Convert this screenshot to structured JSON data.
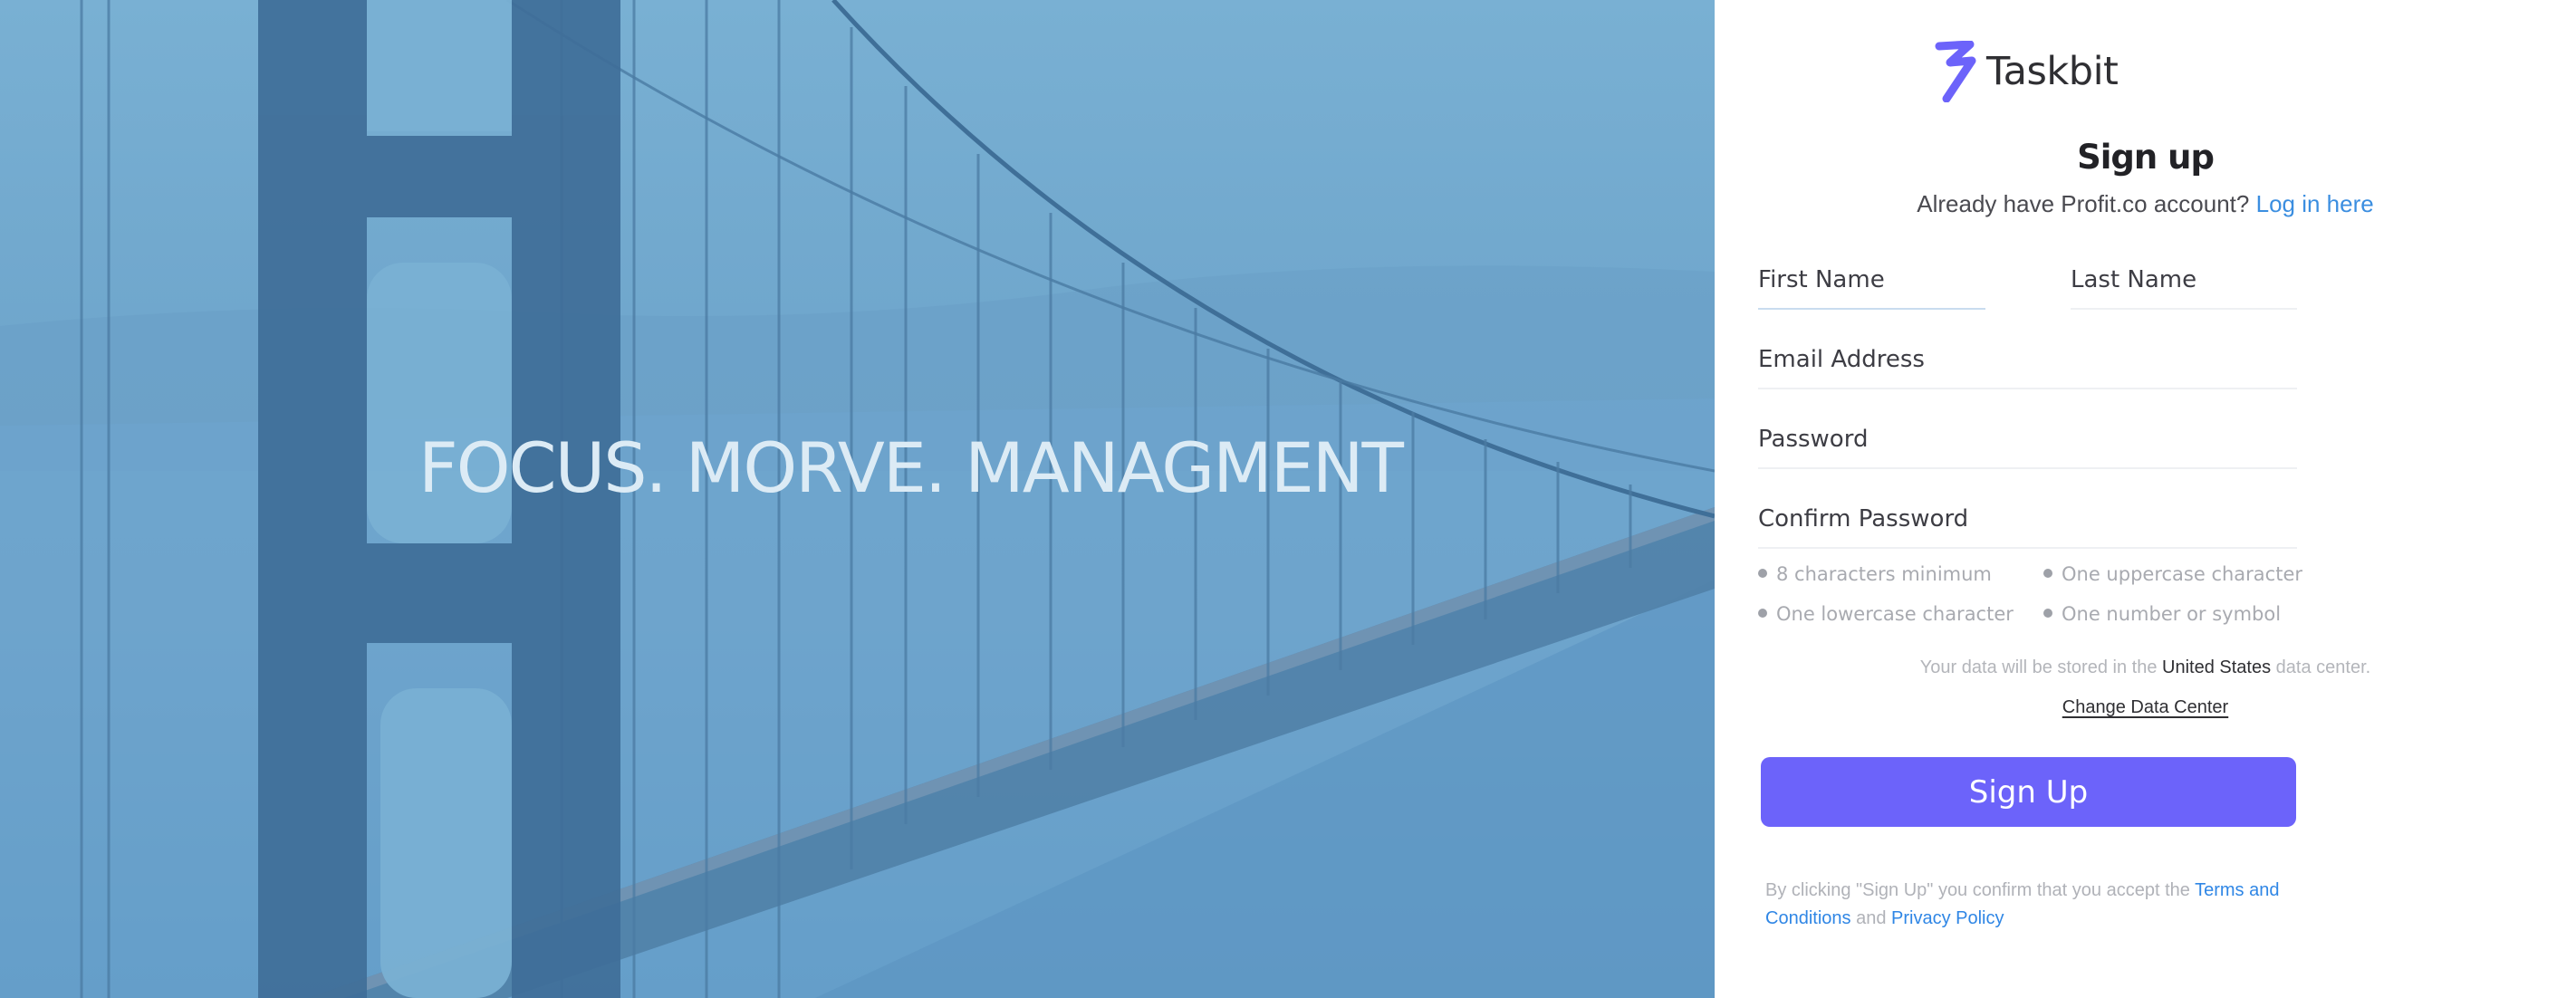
{
  "hero": {
    "tagline": "FOCUS. MORVE. MANAGMENT"
  },
  "brand": {
    "name": "Taskbit",
    "accent": "#6c63fa",
    "link_color": "#3b8ee0",
    "logo_icon": "taskbit-logo-icon"
  },
  "form": {
    "title": "Sign up",
    "subtitle_text": "Already have Profit.co account?",
    "login_link": "Log in here",
    "first_name_placeholder": "First Name",
    "last_name_placeholder": "Last Name",
    "email_placeholder": "Email Address",
    "password_placeholder": "Password",
    "confirm_password_placeholder": "Confirm Password",
    "password_rules": [
      "8 characters minimum",
      "One uppercase character",
      "One lowercase character",
      "One number or symbol"
    ],
    "data_center_prefix": "Your data will be stored in the",
    "data_center_region": "United States",
    "data_center_suffix": "data center.",
    "change_data_center": "Change Data Center",
    "submit_label": "Sign Up",
    "legal_prefix": "By clicking \"Sign Up\" you confirm that you accept the",
    "terms_link": "Terms and Conditions",
    "legal_and": "and",
    "privacy_link": "Privacy Policy"
  }
}
